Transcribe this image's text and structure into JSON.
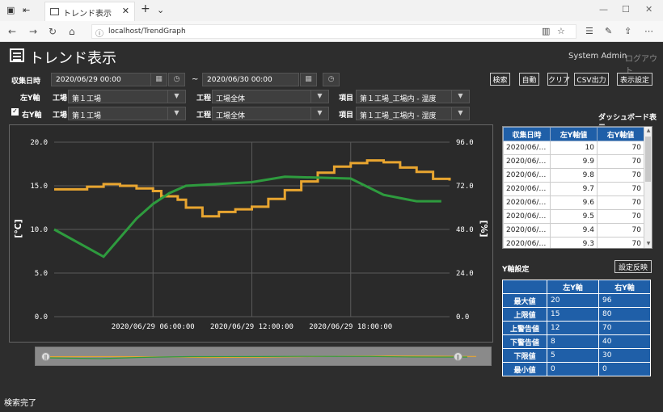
{
  "browser": {
    "tab_title": "トレンド表示",
    "url": "localhost/TrendGraph"
  },
  "app": {
    "title": "トレンド表示",
    "user": "System Admin",
    "logout": "ログアウト"
  },
  "filters": {
    "date_label": "収集日時",
    "date_from": "2020/06/29 00:00",
    "date_to": "2020/06/30 00:00",
    "left_axis_label": "左Y軸",
    "right_axis_label": "右Y軸",
    "factory_label": "工場",
    "process_label": "工程",
    "item_label": "項目",
    "left": {
      "factory": "第１工場",
      "process": "工場全体",
      "item": "第１工場_工場内 - 温度"
    },
    "right": {
      "factory": "第１工場",
      "process": "工場全体",
      "item": "第１工場_工場内 - 湿度"
    }
  },
  "buttons": {
    "search": "検索",
    "auto": "自動",
    "clear": "クリア",
    "csv": "CSV出力",
    "display_settings": "表示設定"
  },
  "dashboard_label": "ダッシュボード表示",
  "chart_data": {
    "type": "line",
    "x_ticks": [
      "2020/06/29 06:00:00",
      "2020/06/29 12:00:00",
      "2020/06/29 18:00:00"
    ],
    "y_left_label": "[℃]",
    "y_right_label": "[%]",
    "y_left_ticks": [
      "20.0",
      "15.0",
      "10.0",
      "5.0",
      "0.0"
    ],
    "y_right_ticks": [
      "96.0",
      "72.0",
      "48.0",
      "24.0",
      "0.0"
    ],
    "y_left_range": [
      0,
      20
    ],
    "y_right_range": [
      0,
      96
    ],
    "series": [
      {
        "axis": "left",
        "color": "#e8a530",
        "hours": [
          0,
          2,
          3,
          4,
          5,
          6,
          6.5,
          7.5,
          8,
          9,
          10,
          11,
          12,
          13,
          14,
          15,
          16,
          17,
          18,
          19,
          20,
          21,
          22,
          23,
          24
        ],
        "values": [
          14.6,
          14.9,
          15.2,
          15.0,
          14.7,
          14.4,
          13.8,
          13.4,
          12.5,
          11.5,
          12.0,
          12.3,
          12.6,
          13.5,
          14.5,
          15.5,
          16.5,
          17.2,
          17.6,
          17.9,
          17.7,
          17.1,
          16.6,
          15.8,
          15.6
        ]
      },
      {
        "axis": "right",
        "color": "#2e9b3e",
        "hours": [
          0,
          3,
          5,
          6,
          7,
          8,
          10,
          12,
          14,
          18,
          20,
          22,
          23.5
        ],
        "values": [
          48.0,
          33.0,
          54.0,
          62.0,
          68.0,
          72.0,
          73.0,
          74.0,
          77.0,
          76.0,
          67.0,
          63.5,
          63.5
        ]
      }
    ]
  },
  "data_table": {
    "headers": [
      "収集日時",
      "左Y軸値",
      "右Y軸値"
    ],
    "rows": [
      [
        "2020/06/…",
        "10",
        "70"
      ],
      [
        "2020/06/…",
        "9.9",
        "70"
      ],
      [
        "2020/06/…",
        "9.8",
        "70"
      ],
      [
        "2020/06/…",
        "9.7",
        "70"
      ],
      [
        "2020/06/…",
        "9.6",
        "70"
      ],
      [
        "2020/06/…",
        "9.5",
        "70"
      ],
      [
        "2020/06/…",
        "9.4",
        "70"
      ],
      [
        "2020/06/…",
        "9.3",
        "70"
      ]
    ]
  },
  "y_settings": {
    "label": "Y軸設定",
    "apply": "設定反映",
    "headers": [
      "",
      "左Y軸",
      "右Y軸"
    ],
    "rows": [
      [
        "最大値",
        "20",
        "96"
      ],
      [
        "上限値",
        "15",
        "80"
      ],
      [
        "上警告値",
        "12",
        "70"
      ],
      [
        "下警告値",
        "8",
        "40"
      ],
      [
        "下限値",
        "5",
        "30"
      ],
      [
        "最小値",
        "0",
        "0"
      ]
    ]
  },
  "status": "検索完了"
}
